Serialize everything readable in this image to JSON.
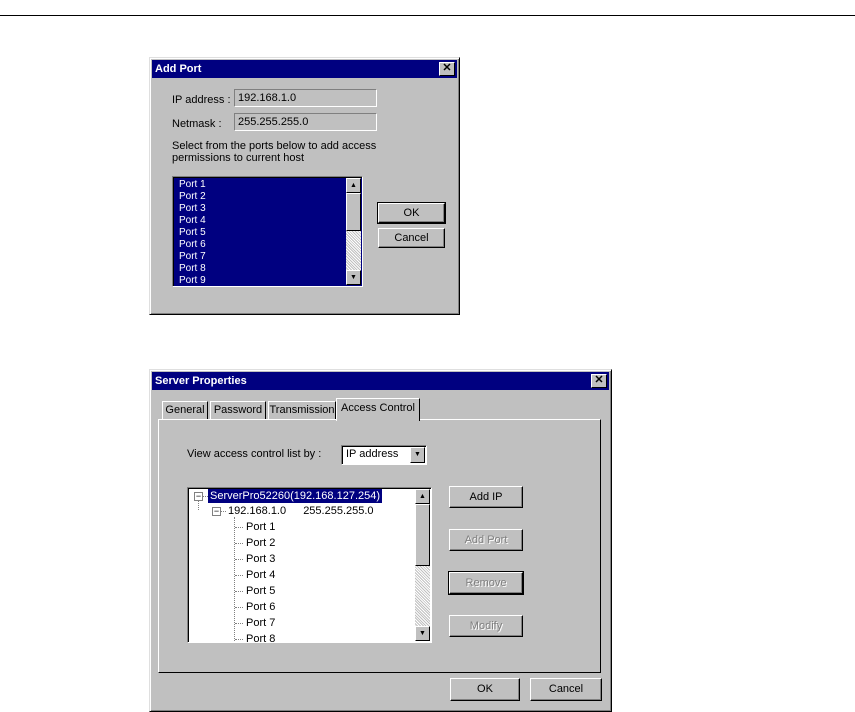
{
  "add_port": {
    "title": "Add Port",
    "ip_label": "IP address :",
    "ip_value": "192.168.1.0",
    "netmask_label": "Netmask :",
    "netmask_value": "255.255.255.0",
    "instructions_line1": "Select from the ports below to add access",
    "instructions_line2": "permissions to current host",
    "ports": [
      "Port 1",
      "Port 2",
      "Port 3",
      "Port 4",
      "Port 5",
      "Port 6",
      "Port 7",
      "Port 8",
      "Port 9"
    ],
    "ok_label": "OK",
    "cancel_label": "Cancel",
    "close_glyph": "✕"
  },
  "server_properties": {
    "title": "Server Properties",
    "close_glyph": "✕",
    "tabs": [
      "General",
      "Password",
      "Transmission",
      "Access Control"
    ],
    "active_tab": "Access Control",
    "view_label": "View access control list by :",
    "view_select_value": "IP address",
    "tree": {
      "root": "ServerPro52260(192.168.127.254)",
      "host_ip": "192.168.1.0",
      "host_mask": "255.255.255.0",
      "ports": [
        "Port 1",
        "Port 2",
        "Port 3",
        "Port 4",
        "Port 5",
        "Port 6",
        "Port 7",
        "Port 8"
      ]
    },
    "buttons": {
      "add_ip": "Add IP",
      "add_port": "Add Port",
      "remove": "Remove",
      "modify": "Modify"
    },
    "ok_label": "OK",
    "cancel_label": "Cancel"
  },
  "colors": {
    "titlebar": "#000080",
    "selection": "#000080",
    "face": "#c0c0c0"
  }
}
